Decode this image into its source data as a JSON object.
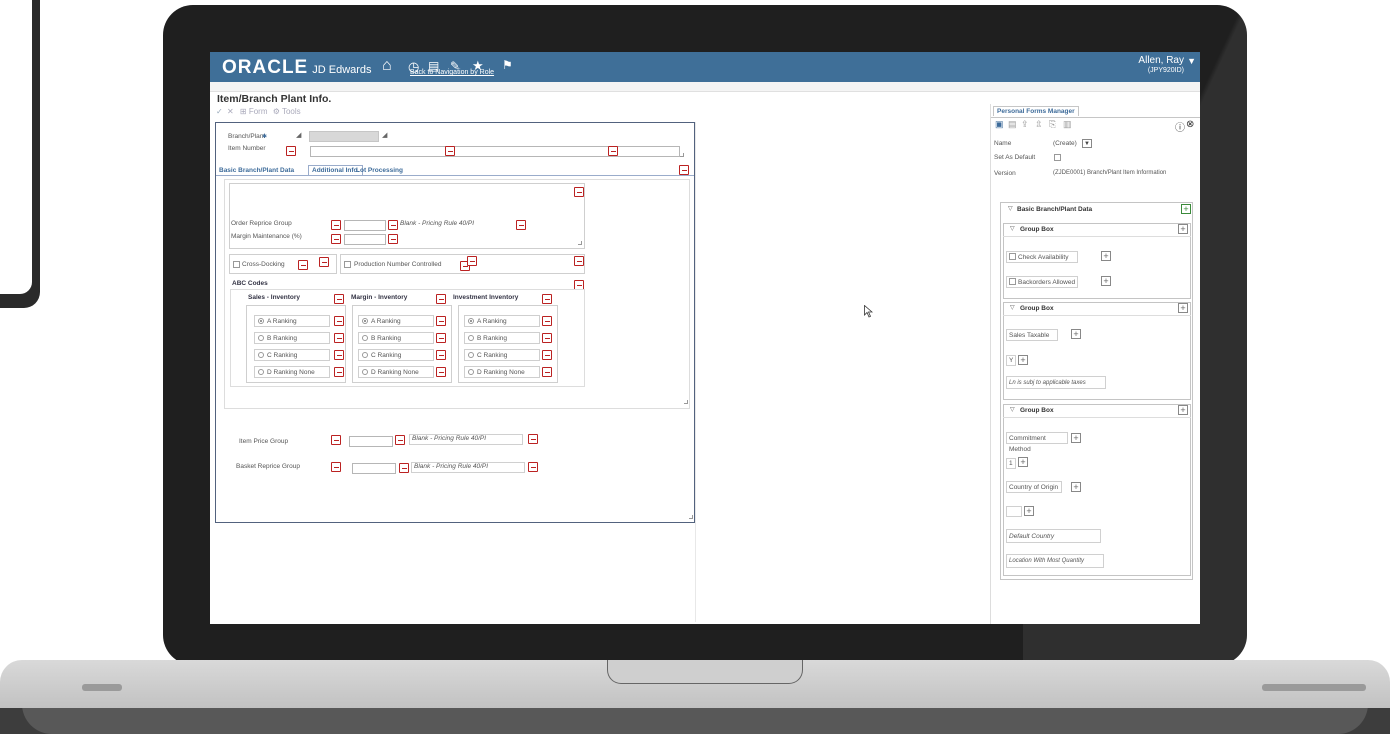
{
  "topbar": {
    "logo": "ORACLE",
    "product": "JD Edwards",
    "back_link": "Back to Navigation by Role",
    "user_name": "Allen, Ray",
    "user_env": "(JPY920ID)"
  },
  "form": {
    "title": "Item/Branch Plant Info.",
    "action_form": "Form",
    "action_tools": "Tools",
    "branch_plant_label": "Branch/Plant",
    "item_number_label": "Item Number"
  },
  "tabs": {
    "basic": "Basic Branch/Plant Data",
    "additional": "Additional Info.",
    "lot": "Lot Processing"
  },
  "additional": {
    "order_reprice_group": "Order Reprice Group",
    "margin_maintenance": "Margin Maintenance (%)",
    "pricing_rule_1": "Blank - Pricing Rule 40/PI",
    "cross_docking": "Cross-Docking",
    "production_number": "Production Number Controlled",
    "abc_codes": "ABC Codes",
    "sales_inventory": "Sales - Inventory",
    "margin_inventory": "Margin - Inventory",
    "investment_inventory": "Investment Inventory",
    "rankings": [
      "A Ranking",
      "B Ranking",
      "C Ranking",
      "D Ranking None"
    ],
    "item_price_group": "Item Price Group",
    "pricing_rule_2": "Blank - Pricing Rule 40/PI",
    "basket_reprice_group": "Basket Reprice Group",
    "pricing_rule_3": "Blank - Pricing Rule 40/PI"
  },
  "pfm": {
    "tab": "Personal Forms Manager",
    "name_label": "Name",
    "name_value": "(Create)",
    "set_default_label": "Set As Default",
    "version_label": "Version",
    "version_value": "(ZJDE0001) Branch/Plant Item Information",
    "section_basic": "Basic Branch/Plant Data",
    "group_box": "Group Box",
    "check_availability": "Check Availability",
    "backorders_allowed": "Backorders Allowed",
    "sales_taxable": "Sales Taxable",
    "sales_taxable_value": "Y",
    "sales_taxable_desc": "Ln is subj to applicable taxes",
    "commitment_method": "Commitment Method",
    "commitment_value": "1",
    "country_origin": "Country of Origin",
    "default_country": "Default Country",
    "location_most_qty": "Location With Most Quantity"
  },
  "colors": {
    "topbar": "#3f6f98",
    "accent_red": "#b22222",
    "laptop_bezel": "#1f1f1f"
  }
}
